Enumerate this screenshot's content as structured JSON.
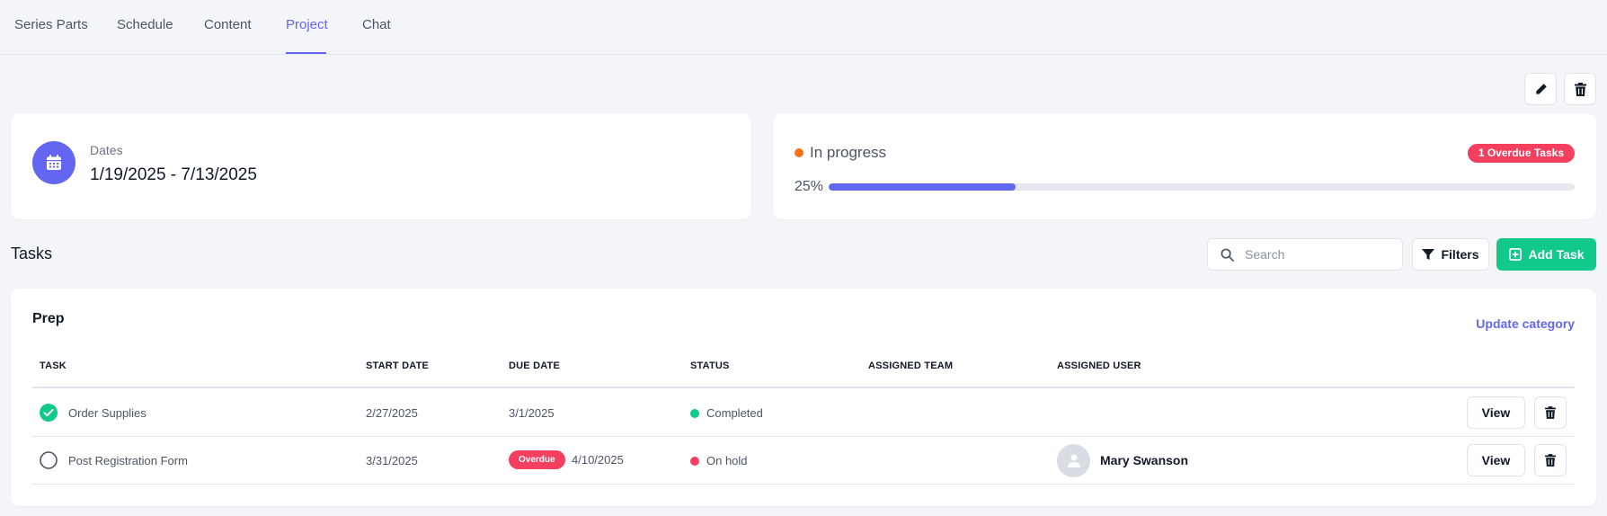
{
  "tabs": [
    {
      "label": "Series Parts"
    },
    {
      "label": "Schedule"
    },
    {
      "label": "Content"
    },
    {
      "label": "Project",
      "active": true
    },
    {
      "label": "Chat"
    }
  ],
  "header_actions": {
    "edit_icon": "pencil-icon",
    "delete_icon": "trash-icon"
  },
  "dates_card": {
    "icon": "calendar-icon",
    "label": "Dates",
    "value": "1/19/2025 - 7/13/2025"
  },
  "status_card": {
    "status": "In progress",
    "status_color": "#f97316",
    "overdue_badge": "1 Overdue Tasks",
    "progress_label": "25%",
    "progress_fraction": 0.25
  },
  "tasks_section": {
    "title": "Tasks",
    "search_placeholder": "Search",
    "filters_label": "Filters",
    "add_task_label": "Add Task"
  },
  "category": {
    "title": "Prep",
    "update_link": "Update category",
    "columns": [
      "TASK",
      "START DATE",
      "DUE DATE",
      "STATUS",
      "ASSIGNED TEAM",
      "ASSIGNED USER"
    ],
    "rows": [
      {
        "task": "Order Supplies",
        "done": true,
        "start_date": "2/27/2025",
        "due_date": "3/1/2025",
        "overdue_tag": "",
        "status": "Completed",
        "status_color": "#10c98a",
        "assigned_team": "",
        "assigned_user": "",
        "view_label": "View"
      },
      {
        "task": "Post Registration Form",
        "done": false,
        "start_date": "3/31/2025",
        "due_date": "4/10/2025",
        "overdue_tag": "Overdue",
        "status": "On hold",
        "status_color": "#f43f5e",
        "assigned_team": "",
        "assigned_user": "Mary Swanson",
        "view_label": "View"
      }
    ]
  },
  "colors": {
    "accent": "#6366f1",
    "success": "#10c98a",
    "danger": "#f43f5e",
    "warning": "#f97316"
  }
}
